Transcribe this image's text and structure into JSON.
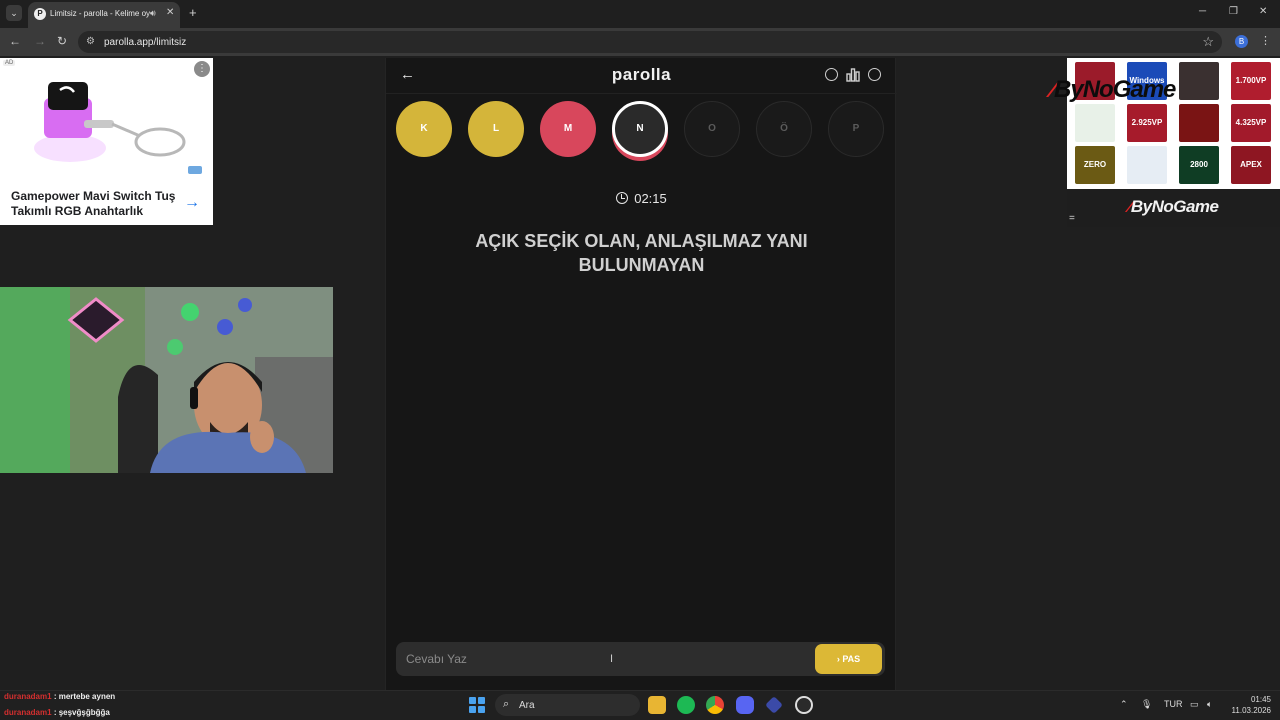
{
  "browser": {
    "tab_title": "Limitsiz - parolla - Kelime oyunu",
    "url": "parolla.app/limitsiz",
    "profile_initial": "B"
  },
  "ad_left": {
    "badge": "AD",
    "title": "Gamepower Mavi Switch Tuş Takımlı RGB Anahtarlık"
  },
  "app": {
    "brand": "parolla",
    "letters": [
      {
        "letter": "K",
        "state": "correct",
        "color": "#d4b53a",
        "text_color": "#ffffff"
      },
      {
        "letter": "L",
        "state": "correct",
        "color": "#d4b53a",
        "text_color": "#ffffff"
      },
      {
        "letter": "M",
        "state": "wrong",
        "color": "#d8475c",
        "text_color": "#ffffff"
      },
      {
        "letter": "N",
        "state": "current",
        "color": "#2a2a2a",
        "text_color": "#ffffff"
      },
      {
        "letter": "O",
        "state": "pending",
        "color": "#1a1a1a",
        "text_color": "#5b5b5b"
      },
      {
        "letter": "Ö",
        "state": "pending",
        "color": "#1a1a1a",
        "text_color": "#5b5b5b"
      },
      {
        "letter": "P",
        "state": "pending",
        "color": "#1a1a1a",
        "text_color": "#5b5b5b"
      }
    ],
    "timer": "02:15",
    "question": "AÇIK SEÇİK OLAN, ANLAŞILMAZ YANI BULUNMAYAN",
    "answer_placeholder": "Cevabı Yaz",
    "pass_label": "PAS"
  },
  "right_ad": {
    "logo": "ByNoGame",
    "tiles": [
      "",
      "Windows",
      "",
      "1.700VP",
      "",
      "2.925VP",
      "",
      "4.325VP",
      "ZERO",
      "",
      "2800",
      "APEX"
    ],
    "banner": "ByNoGame"
  },
  "chat": [
    {
      "user": "duranadam1",
      "message": ": mertebe aynen"
    },
    {
      "user": "duranadam1",
      "message": ": şeşvğşğbğğa"
    }
  ],
  "taskbar": {
    "search": "Ara",
    "lang": "TUR",
    "time": "01:45",
    "date": "11.03.2026"
  },
  "colors": {
    "accent_yellow": "#dcb836",
    "accent_red": "#d8475c",
    "bg": "#161616"
  }
}
